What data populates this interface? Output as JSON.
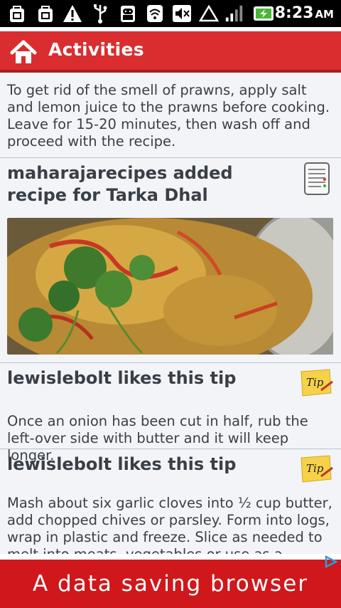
{
  "status_bar": {
    "time": "8:23",
    "ampm": "AM",
    "icons": [
      "bag-icon",
      "bag-icon",
      "warning-icon",
      "usb-icon",
      "android-debug-icon",
      "wifi-icon",
      "mute-icon",
      "triangle-icon",
      "signal-icon",
      "battery-charging-icon"
    ]
  },
  "header": {
    "title": "Activities",
    "icon": "home-icon",
    "accent_color": "#d92d2f"
  },
  "feed": {
    "items": [
      {
        "type": "tip-text",
        "text": "To get rid of the smell of prawns, apply salt and lemon juice to the prawns before cooking. Leave for 15-20 minutes, then wash off and proceed with the recipe."
      },
      {
        "type": "recipe",
        "title": "maharajarecipes added recipe for Tarka Dhal",
        "icon": "recipe-list-icon"
      },
      {
        "type": "tip",
        "title": "lewislebolt likes this tip",
        "icon": "tip-note-icon",
        "icon_label": "Tip",
        "text": "Once an onion has been cut in half, rub the left-over side with butter and it will keep longer."
      },
      {
        "type": "tip",
        "title": "lewislebolt likes this tip",
        "icon": "tip-note-icon",
        "icon_label": "Tip",
        "text": "Mash about six garlic cloves into ½ cup butter, add chopped chives or parsley. Form into logs, wrap in plastic and freeze. Slice as needed to melt into meats, vegetables or use as a spread."
      }
    ]
  },
  "ad": {
    "text": "A data saving browser",
    "background": "#d0171b"
  }
}
